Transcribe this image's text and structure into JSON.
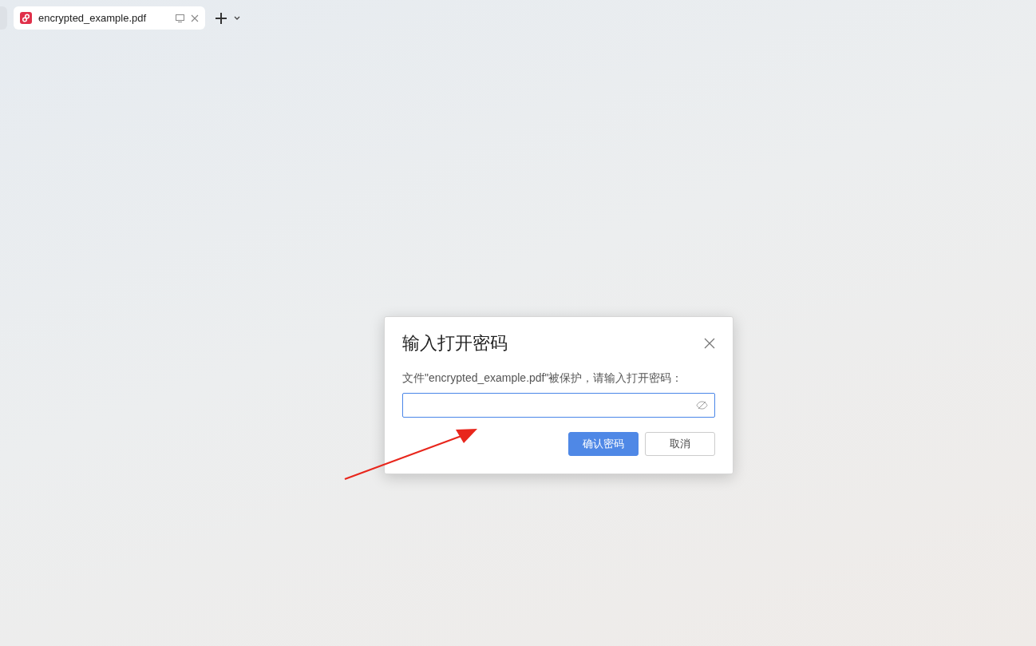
{
  "tabs": [
    {
      "label": "encrypted_example.pdf",
      "selected": true
    }
  ],
  "dialog": {
    "title": "输入打开密码",
    "message": "文件\"encrypted_example.pdf\"被保护，请输入打开密码：",
    "password_field": {
      "focused": true
    },
    "buttons": [
      {
        "label": "确认密码",
        "kind": "primary"
      },
      {
        "label": "取消",
        "kind": "secondary"
      }
    ]
  }
}
